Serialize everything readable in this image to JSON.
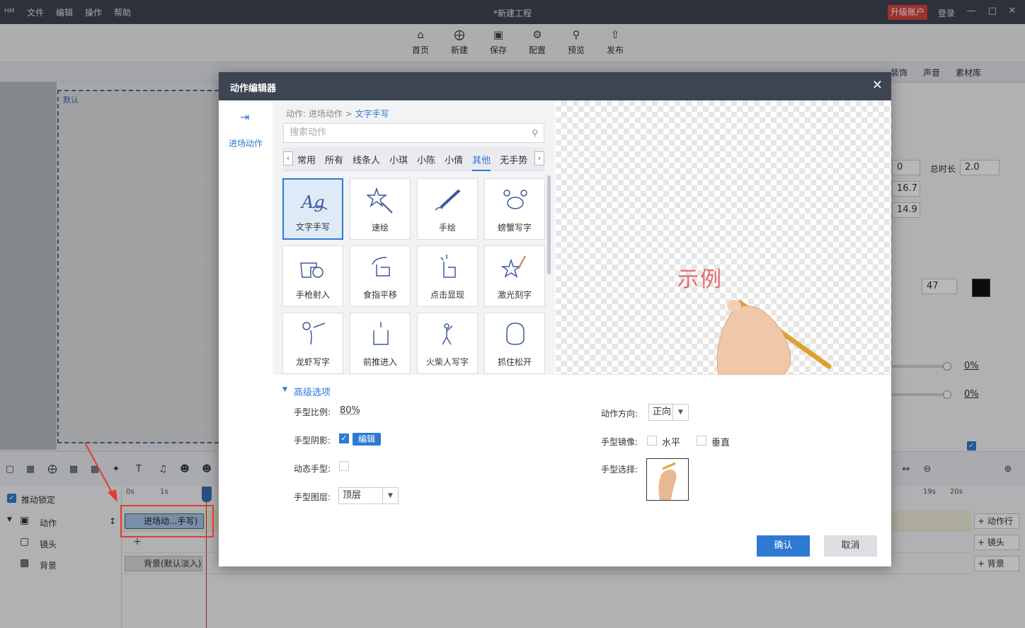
{
  "app": {
    "logo": "HM",
    "menu": [
      "文件",
      "编辑",
      "操作",
      "帮助"
    ],
    "window_title": "*新建工程",
    "upgrade_label": "升级账户",
    "login_label": "登录",
    "window_controls": [
      "minimize-icon",
      "maximize-icon",
      "close-icon"
    ]
  },
  "toolbar": {
    "buttons": [
      {
        "label": "首页",
        "icon": "home-icon"
      },
      {
        "label": "新建",
        "icon": "new-icon"
      },
      {
        "label": "保存",
        "icon": "save-icon"
      },
      {
        "label": "配置",
        "icon": "settings-icon"
      },
      {
        "label": "预览",
        "icon": "preview-icon"
      },
      {
        "label": "发布",
        "icon": "publish-icon"
      }
    ]
  },
  "right_tabs": [
    "装饰",
    "声音",
    "素材库"
  ],
  "canvas": {
    "tag": "默认"
  },
  "right_panel": {
    "field1": "0",
    "total_label": "总时长",
    "total_value": "2.0",
    "field2": "16.7",
    "field3": "14.9",
    "font_size": "47",
    "pct1": "0%",
    "pct2": "0%"
  },
  "timeline": {
    "lock_label": "推动锁定",
    "rows": [
      {
        "label": "动作",
        "icon": "action-icon"
      },
      {
        "label": "镜头",
        "icon": "camera-icon"
      },
      {
        "label": "背景",
        "icon": "background-icon"
      }
    ],
    "ruler": {
      "t0": "0s",
      "t1": "1s",
      "t19": "19s",
      "t20": "20s"
    },
    "action_clip": "进场动...手写)",
    "bg_clip": "背景(默认淡入)",
    "add_buttons": [
      "+ 动作行",
      "+ 镜头",
      "+ 背景"
    ]
  },
  "dialog": {
    "title": "动作编辑器",
    "side_label": "进场动作",
    "breadcrumb_prefix": "动作: 进场动作 >",
    "breadcrumb_current": "文字手写",
    "search_placeholder": "搜索动作",
    "categories": [
      "常用",
      "所有",
      "线条人",
      "小琪",
      "小陈",
      "小倩",
      "其他",
      "无手势"
    ],
    "active_category": "其他",
    "actions": [
      {
        "label": "文字手写",
        "icon": "handwriting-icon",
        "selected": true
      },
      {
        "label": "速绘",
        "icon": "quick-draw-icon",
        "selected": false
      },
      {
        "label": "手绘",
        "icon": "pen-draw-icon",
        "selected": false
      },
      {
        "label": "螃蟹写字",
        "icon": "crab-icon",
        "selected": false
      },
      {
        "label": "手枪射入",
        "icon": "hand-gun-icon",
        "selected": false
      },
      {
        "label": "食指平移",
        "icon": "finger-swipe-icon",
        "selected": false
      },
      {
        "label": "点击显现",
        "icon": "finger-tap-icon",
        "selected": false
      },
      {
        "label": "激光刻字",
        "icon": "laser-icon",
        "selected": false
      },
      {
        "label": "龙虾写字",
        "icon": "lobster-icon",
        "selected": false
      },
      {
        "label": "前推进入",
        "icon": "push-hand-icon",
        "selected": false
      },
      {
        "label": "火柴人写字",
        "icon": "stickman-icon",
        "selected": false
      },
      {
        "label": "抓住松开",
        "icon": "grab-hand-icon",
        "selected": false
      }
    ],
    "preview_sample_text": "示例",
    "advanced": {
      "header": "高级选项",
      "hand_scale_label": "手型比例:",
      "hand_scale_value": "80%",
      "hand_shadow_label": "手型阴影:",
      "edit_label": "编辑",
      "dynamic_hand_label": "动态手型:",
      "hand_layer_label": "手型图层:",
      "hand_layer_value": "顶层",
      "direction_label": "动作方向:",
      "direction_value": "正向",
      "mirror_label": "手型镜像:",
      "mirror_h": "水平",
      "mirror_v": "垂直",
      "hand_select_label": "手型选择:"
    },
    "confirm_label": "确认",
    "cancel_label": "取消"
  }
}
